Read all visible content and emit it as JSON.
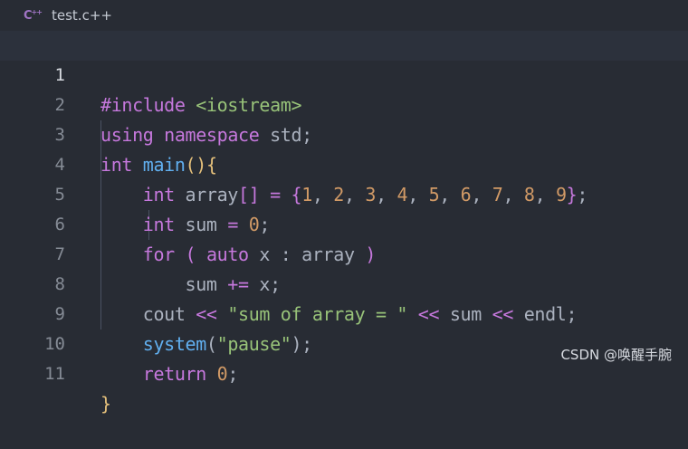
{
  "tab": {
    "icon": "cpp-file-icon",
    "icon_label": "C++",
    "title": "test.c++"
  },
  "editor": {
    "active_line": 1,
    "lines": [
      {
        "number": "1",
        "text": "#include <iostream>"
      },
      {
        "number": "2",
        "text": "using namespace std;"
      },
      {
        "number": "3",
        "text": "int main(){"
      },
      {
        "number": "4",
        "text": "    int array[] = {1, 2, 3, 4, 5, 6, 7, 8, 9};"
      },
      {
        "number": "5",
        "text": "    int sum = 0;"
      },
      {
        "number": "6",
        "text": "    for ( auto x : array )"
      },
      {
        "number": "7",
        "text": "        sum += x;"
      },
      {
        "number": "8",
        "text": "    cout << \"sum of array = \" << sum << endl;"
      },
      {
        "number": "9",
        "text": "    system(\"pause\");"
      },
      {
        "number": "10",
        "text": "    return 0;"
      },
      {
        "number": "11",
        "text": "}"
      }
    ]
  },
  "watermark": "CSDN @唤醒手腕",
  "colors": {
    "background": "#282c34",
    "keyword": "#c678dd",
    "function": "#61afef",
    "number": "#d19a66",
    "string": "#98c379",
    "brace": "#e5c07b",
    "plain": "#abb2bf"
  }
}
